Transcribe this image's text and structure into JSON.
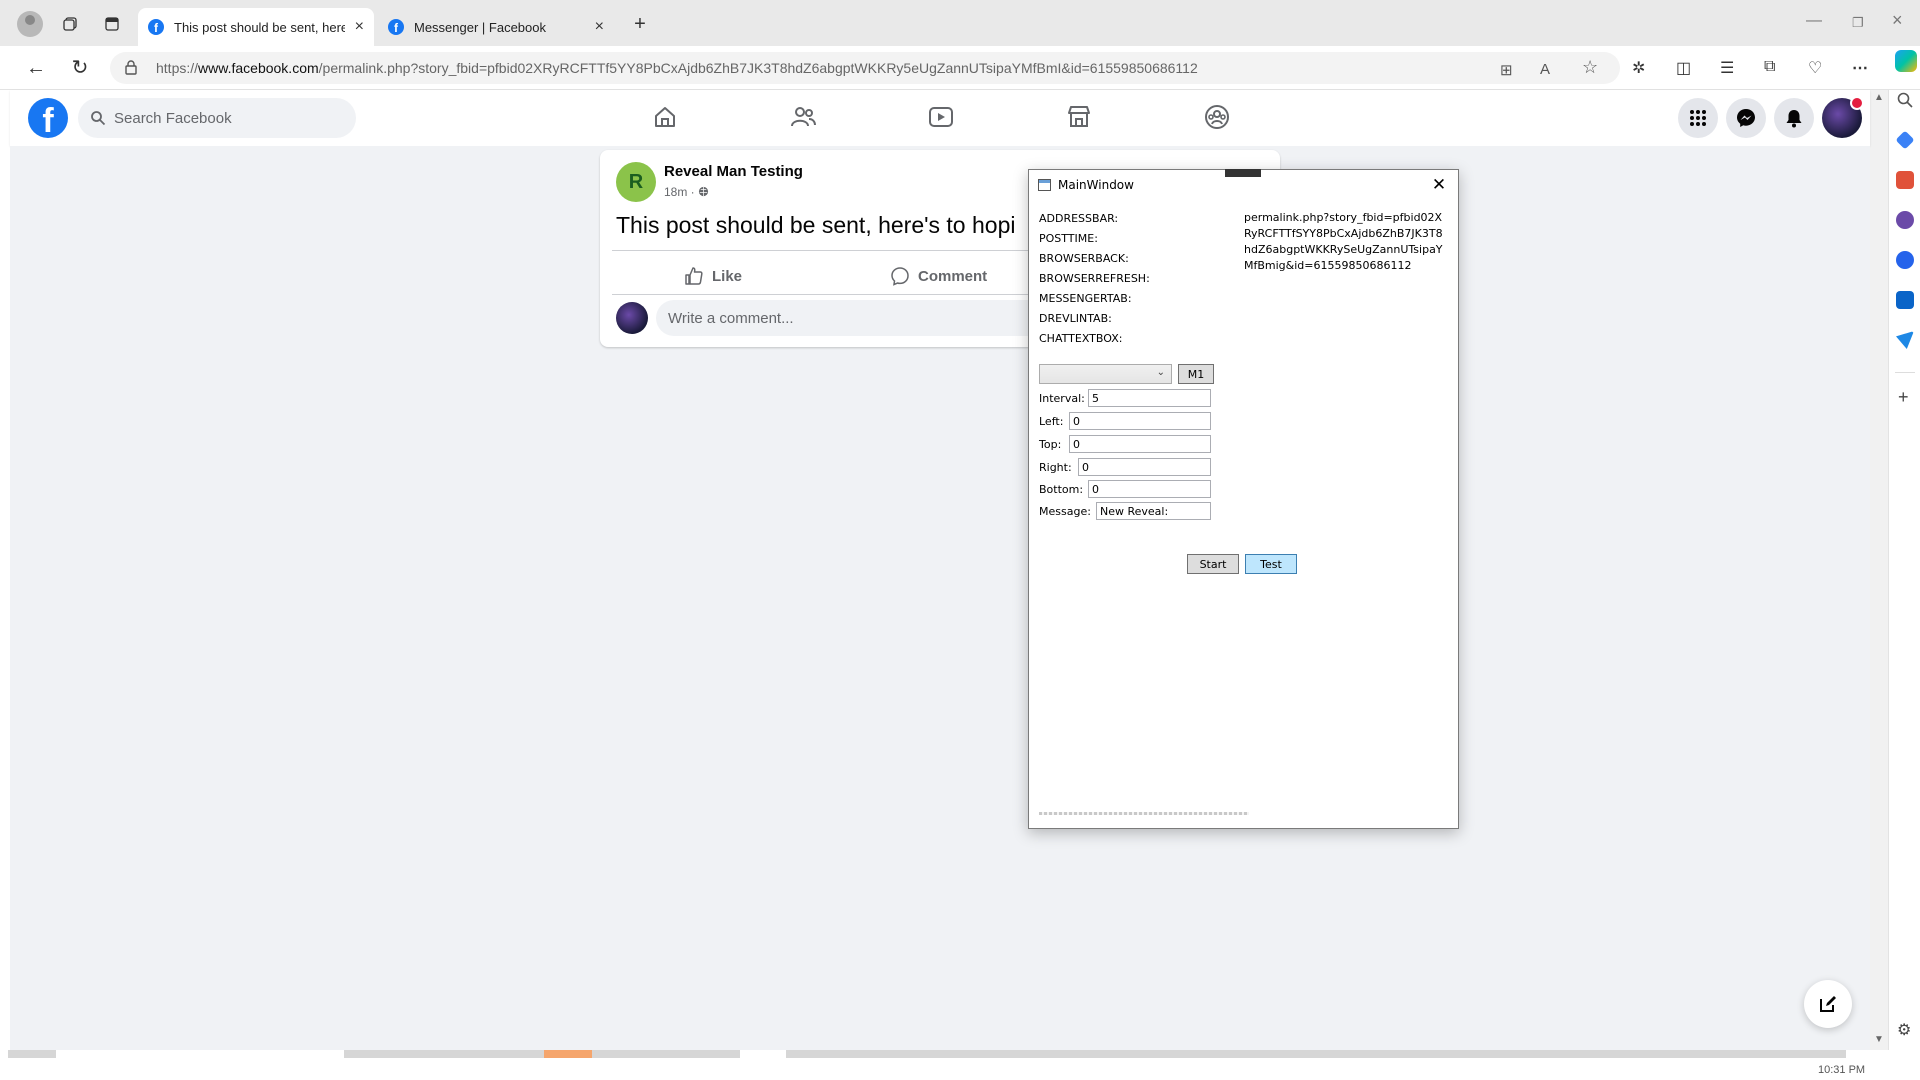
{
  "browser": {
    "tabs": [
      {
        "title": "This post should be sent, here's t",
        "active": true
      },
      {
        "title": "Messenger | Facebook",
        "active": false
      }
    ],
    "url_prefix": "https://",
    "url_domain": "www.facebook.com",
    "url_path": "/permalink.php?story_fbid=pfbid02XRyRCFTTf5YY8PbCxAjdb6ZhB7JK3T8hdZ6abgptWKKRy5eUgZannUTsipaYMfBmI&id=61559850686112",
    "new_tab_icon": "+",
    "close_icon": "×",
    "taskbar_clock": "10:31 PM"
  },
  "facebook": {
    "search_placeholder": "Search Facebook",
    "nav_icons": [
      "home-icon",
      "friends-icon",
      "video-icon",
      "marketplace-icon",
      "groups-icon"
    ],
    "accent": "#1877f2",
    "post": {
      "avatar_letter": "R",
      "author": "Reveal Man Testing",
      "meta": "18m ·",
      "text": "This post should be sent, here's to hopi",
      "like_label": "Like",
      "comment_label": "Comment",
      "comment_placeholder": "Write a comment..."
    }
  },
  "main_window": {
    "title": "MainWindow",
    "labels": [
      "ADDRESSBAR:",
      "POSTTIME:",
      "BROWSERBACK:",
      "BROWSERREFRESH:",
      "MESSENGERTAB:",
      "DREVLINTAB:",
      "CHATTEXTBOX:"
    ],
    "addressbar_value": "permalink.php?story_fbid=pfbid02XRyRCFTTfSYY8PbCxAjdb6ZhB7JK3T8hdZ6abgptWKKRySeUgZannUTsipaYMfBmig&id=61559850686112",
    "m1_label": "M1",
    "fields": {
      "interval_label": "Interval:",
      "interval_value": "5",
      "left_label": "Left:",
      "left_value": "0",
      "top_label": "Top:",
      "top_value": "0",
      "right_label": "Right:",
      "right_value": "0",
      "bottom_label": "Bottom:",
      "bottom_value": "0",
      "message_label": "Message:",
      "message_value": "New Reveal:"
    },
    "start_label": "Start",
    "test_label": "Test"
  }
}
